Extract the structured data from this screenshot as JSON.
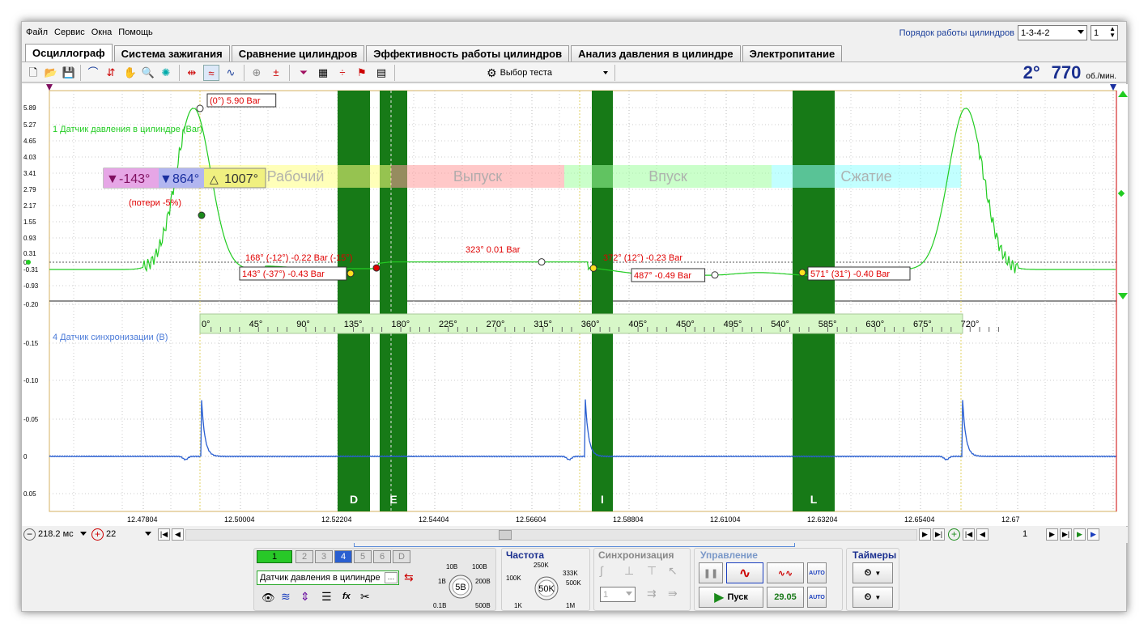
{
  "menu": [
    "Файл",
    "Сервис",
    "Окна",
    "Помощь"
  ],
  "firing_order": {
    "label": "Порядок работы цилиндров",
    "value": "1-3-4-2",
    "cylinder": "1"
  },
  "tabs": [
    "Осциллограф",
    "Система зажигания",
    "Сравнение цилиндров",
    "Эффективность работы цилиндров",
    "Анализ давления в цилиндре",
    "Электропитание"
  ],
  "toolbar": {
    "test_select": "Выбор теста"
  },
  "rpm": {
    "angle": "2°",
    "value": "770",
    "unit": "об./мин."
  },
  "plot": {
    "ch1_label": "1 Датчик давления в цилиндре (Bar)",
    "ch4_label": "4 Датчик синхронизации (В)",
    "y1_ticks": [
      "5.89",
      "5.27",
      "4.65",
      "4.03",
      "3.41",
      "2.79",
      "2.17",
      "1.55",
      "0.93",
      "0.31",
      "0",
      "-0.31",
      "-0.93"
    ],
    "y4_ticks": [
      "-0.20",
      "-0.15",
      "-0.10",
      "-0.05",
      "0",
      "0.05"
    ],
    "x_ticks": [
      "12.47804",
      "12.50004",
      "12.52204",
      "12.54404",
      "12.56604",
      "12.58804",
      "12.61004",
      "12.63204",
      "12.65404",
      "12.67"
    ],
    "angle_ticks": [
      "0°",
      "45°",
      "90°",
      "135°",
      "180°",
      "225°",
      "270°",
      "315°",
      "360°",
      "405°",
      "450°",
      "495°",
      "540°",
      "585°",
      "630°",
      "675°",
      "720°"
    ],
    "strokes": [
      "Рабочий",
      "Выпуск",
      "Впуск",
      "Сжатие"
    ],
    "cursor_a": "-143°",
    "cursor_b": "864°",
    "cursor_delta": "1007°",
    "annotations": [
      {
        "text": "(0°) 5.90 Bar",
        "boxed": true
      },
      {
        "text": "(потери -5%)",
        "boxed": false
      },
      {
        "text": "168° (-12°) -0.22 Bar (-15°)",
        "boxed": false
      },
      {
        "text": "143° (-37°) -0.43 Bar",
        "boxed": true
      },
      {
        "text": "323° 0.01 Bar",
        "boxed": false
      },
      {
        "text": "372° (12°) -0.23 Bar",
        "boxed": false
      },
      {
        "text": "487° -0.49 Bar",
        "boxed": true
      },
      {
        "text": "571° (31°) -0.40 Bar",
        "boxed": true
      }
    ],
    "valve_letters": [
      "D",
      "E",
      "I",
      "L"
    ]
  },
  "bottom": {
    "timebase": "218.2 мс",
    "buffer": "22",
    "frame": "1"
  },
  "channels": [
    "1",
    "2",
    "3",
    "4",
    "5",
    "6",
    "D"
  ],
  "sensor": "Датчик давления в цилиндре",
  "amplitude": {
    "value": "5В",
    "ticks": [
      "10В",
      "100В",
      "1В",
      "200В",
      "0.1В",
      "500В"
    ]
  },
  "frequency": {
    "title": "Частота",
    "value": "50K",
    "ticks": [
      "250K",
      "100K",
      "333K",
      "500K",
      "1K",
      "1M"
    ]
  },
  "sync": {
    "title": "Синхронизация",
    "value": "1"
  },
  "control": {
    "title": "Управление",
    "start": "Пуск",
    "fps": "29.05"
  },
  "timers": {
    "title": "Таймеры"
  },
  "colors": {
    "pressure": "#22cc22",
    "sync_signal": "#2a5fd0",
    "valve_band": "#177a17",
    "annot": "#e00000"
  }
}
